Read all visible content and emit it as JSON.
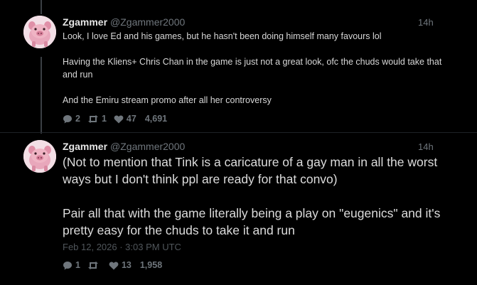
{
  "posts": [
    {
      "user": "Zgammer",
      "handle": "@Zgammer2000",
      "time": "14h",
      "paragraphs": [
        "Look, I love Ed and his games, but he hasn't been doing himself many favours lol",
        "Having the Kliens+ Chris Chan in the game is just not a great look, ofc the chuds would take that and run",
        "And the Emiru stream promo after all her controversy"
      ],
      "replies": "2",
      "reposts": "1",
      "likes": "47",
      "views": "4,691"
    },
    {
      "user": "Zgammer",
      "handle": "@Zgammer2000",
      "time": "14h",
      "paragraphs": [
        "(Not to mention that Tink is a caricature of a gay man in all the worst ways but I don't think ppl are ready for that convo)",
        "Pair all that with the game literally being a play on \"eugenics\" and it's pretty easy for the chuds to take it and run"
      ],
      "date": "Feb 12, 2026 · 3:03 PM UTC",
      "replies": "1",
      "reposts": "",
      "likes": "13",
      "views": "1,958"
    }
  ],
  "colors": {
    "background": "#000000",
    "text": "#d9d9d9",
    "muted": "#6f767c",
    "thread_line": "#3a3f44"
  },
  "icons": [
    "pig-avatar-icon",
    "reply-icon",
    "repost-icon",
    "like-icon"
  ]
}
